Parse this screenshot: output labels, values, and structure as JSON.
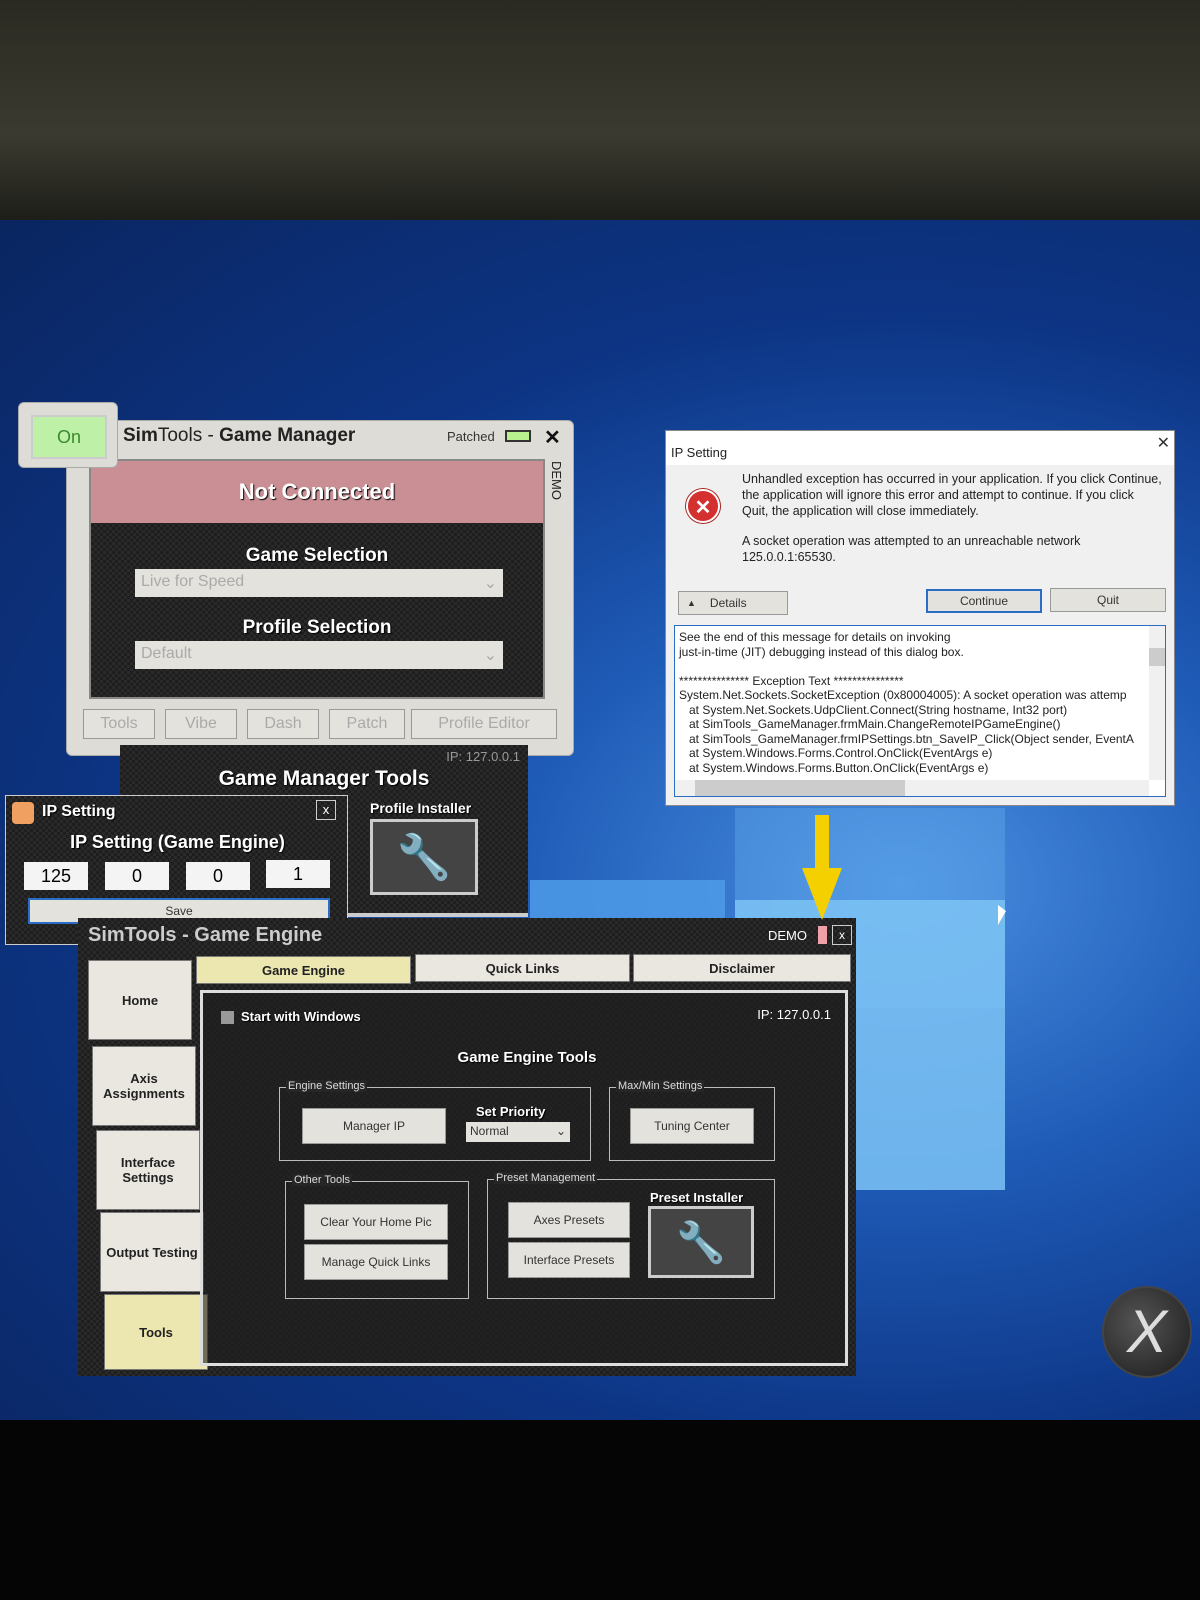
{
  "game_manager": {
    "on_label": "On",
    "title_sim": "Sim",
    "title_tools": "Tools - ",
    "title_gm": "Game Manager",
    "patched_label": "Patched",
    "close": "✕",
    "demo_label": "DEMO",
    "status": "Not Connected",
    "game_selection_label": "Game Selection",
    "game_selection_value": "Live for Speed",
    "profile_selection_label": "Profile Selection",
    "profile_selection_value": "Default",
    "tabs": [
      "Tools",
      "Vibe",
      "Dash",
      "Patch",
      "Profile Editor"
    ]
  },
  "gm_tools": {
    "title": "Game Manager Tools",
    "ip": "IP: 127.0.0.1",
    "profile_installer": "Profile Installer"
  },
  "ip_small": {
    "title": "IP Setting",
    "close": "x",
    "heading": "IP Setting (Game Engine)",
    "octets": [
      "125",
      "0",
      "0",
      "1"
    ],
    "save": "Save"
  },
  "error_dialog": {
    "title": "IP Setting",
    "close": "✕",
    "message": "Unhandled exception has occurred in your application. If you click Continue, the application will ignore this error and attempt to continue. If you click Quit, the application will close immediately.",
    "detail": "A socket operation was attempted to an unreachable network 125.0.0.1:65530.",
    "details_button": "Details",
    "continue_button": "Continue",
    "quit_button": "Quit",
    "details_text": [
      "See the end of this message for details on invoking",
      "just-in-time (JIT) debugging instead of this dialog box.",
      "",
      "*************** Exception Text ***************",
      "System.Net.Sockets.SocketException (0x80004005): A socket operation was attemp",
      "   at System.Net.Sockets.UdpClient.Connect(String hostname, Int32 port)",
      "   at SimTools_GameManager.frmMain.ChangeRemoteIPGameEngine()",
      "   at SimTools_GameManager.frmIPSettings.btn_SaveIP_Click(Object sender, EventA",
      "   at System.Windows.Forms.Control.OnClick(EventArgs e)",
      "   at System.Windows.Forms.Button.OnClick(EventArgs e)"
    ]
  },
  "game_engine": {
    "title": "SimTools - Game Engine",
    "demo_label": "DEMO",
    "close": "x",
    "tabs": [
      "Game Engine",
      "Quick Links",
      "Disclaimer"
    ],
    "sidebar": [
      "Home",
      "Axis Assignments",
      "Interface Settings",
      "Output Testing",
      "Tools"
    ],
    "start_with_windows": "Start with Windows",
    "ip": "IP: 127.0.0.1",
    "tools_title": "Game Engine Tools",
    "engine_settings": "Engine Settings",
    "manager_ip": "Manager IP",
    "set_priority": "Set Priority",
    "priority_value": "Normal",
    "maxmin_settings": "Max/Min Settings",
    "tuning_center": "Tuning Center",
    "other_tools": "Other Tools",
    "clear_home_pic": "Clear Your Home Pic",
    "manage_quick_links": "Manage Quick Links",
    "preset_management": "Preset Management",
    "axes_presets": "Axes Presets",
    "interface_presets": "Interface Presets",
    "preset_installer": "Preset Installer"
  },
  "colors": {
    "not_connected": "#c98f94",
    "active_tab": "#ece6b0",
    "arrow": "#f5d000",
    "accent_blue": "#2b6cc4"
  }
}
